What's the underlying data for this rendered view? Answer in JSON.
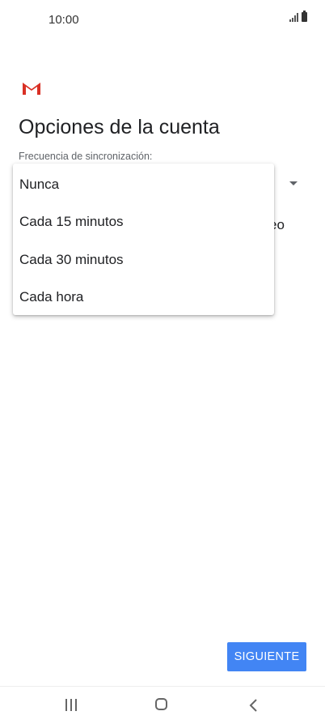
{
  "status_bar": {
    "time": "10:00"
  },
  "header": {
    "title": "Opciones de la cuenta"
  },
  "sync_field": {
    "label": "Frecuencia de sincronización:"
  },
  "background": {
    "partial_text": "eo"
  },
  "dropdown_menu": {
    "items": [
      {
        "label": "Nunca"
      },
      {
        "label": "Cada 15 minutos"
      },
      {
        "label": "Cada 30 minutos"
      },
      {
        "label": "Cada hora"
      }
    ]
  },
  "footer": {
    "next_label": "SIGUIENTE"
  },
  "colors": {
    "accent": "#4285f4",
    "gmail_red": "#d93025"
  },
  "icons": [
    "gmail-logo",
    "signal-icon",
    "battery-icon",
    "dropdown-arrow-icon",
    "recents-icon",
    "home-icon",
    "back-icon"
  ]
}
